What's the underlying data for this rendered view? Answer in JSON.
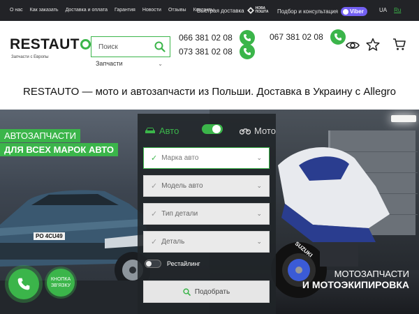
{
  "topbar": {
    "nav": [
      "О нас",
      "Как заказать",
      "Доставка и оплата",
      "Гарантия",
      "Новости",
      "Отзывы",
      "Контакты"
    ],
    "fast_delivery": "Быстрая доставка",
    "carrier_line1": "НОВА",
    "carrier_line2": "ПОШТА",
    "consultation": "Подбор и консультация",
    "viber": "Viber",
    "lang_ua": "UA",
    "lang_ru": "Ru"
  },
  "header": {
    "logo_text": "RESTAUT",
    "tagline": "Запчасти с Европы",
    "search_placeholder": "Поиск",
    "catalog_label": "Запчасти",
    "phone_1": "066 381 02 08",
    "phone_2": "073 381 02 08",
    "phone_3": "067 381 02 08"
  },
  "headline": "RESTAUTO — мото и автозапчасти из Польши. Доставка в Украину с Allegro",
  "hero": {
    "promo_car_line1": "АВТОЗАПЧАСТИ",
    "promo_car_line2": "ДЛЯ ВСЕХ МАРОК АВТО",
    "promo_moto_line1": "МОТОЗАПЧАСТИ",
    "promo_moto_line2": "И МОТОЭКИПИРОВКА",
    "car_plate": "PO 4CU49",
    "moto_brand": "SUZUKI"
  },
  "form": {
    "mode_auto": "Авто",
    "mode_moto": "Мото",
    "fields": [
      "Марка авто",
      "Модель авто",
      "Тип детали",
      "Деталь"
    ],
    "restyle_label": "Рестайлинг",
    "submit_label": "Подобрать"
  },
  "floating": {
    "call_button": "КНОПКА ЗВ'ЯЗКУ"
  },
  "colors": {
    "accent": "#3bb54a",
    "topbar": "#222327",
    "viber": "#7360f2"
  }
}
